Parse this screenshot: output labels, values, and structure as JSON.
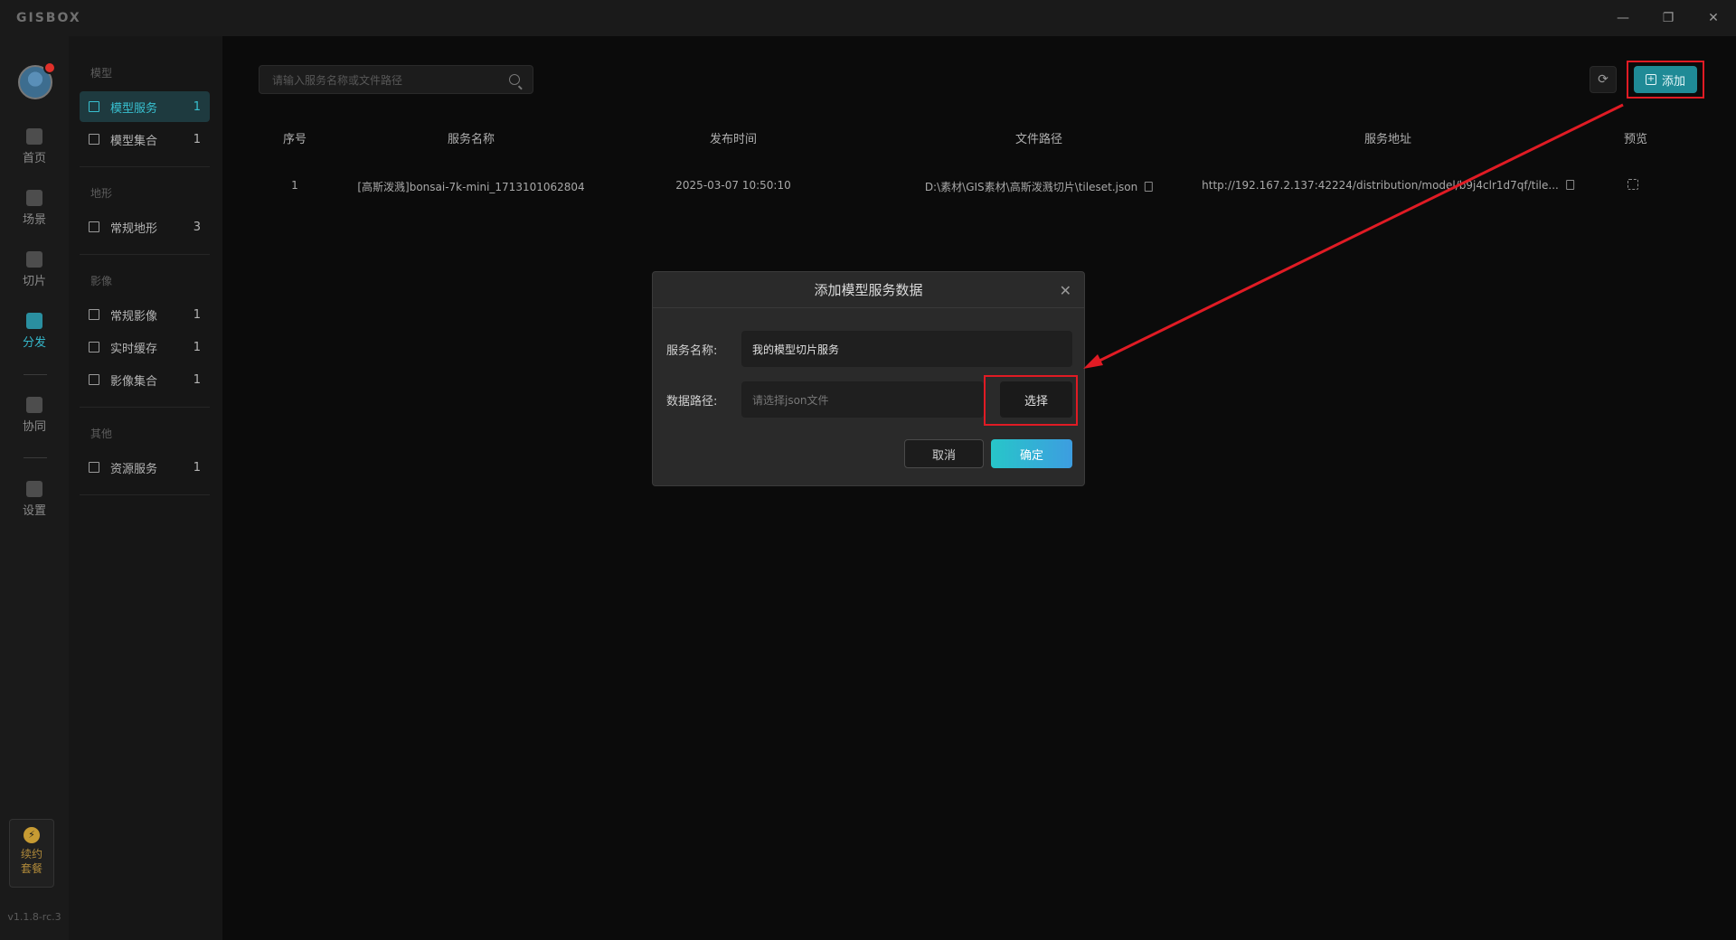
{
  "app": {
    "logo": "GISBOX"
  },
  "window": {
    "minimize": "—",
    "restore": "❐",
    "close": "✕"
  },
  "rail": {
    "items": [
      {
        "label": "首页",
        "icon": "home-icon"
      },
      {
        "label": "场景",
        "icon": "scene-icon"
      },
      {
        "label": "切片",
        "icon": "slice-icon"
      },
      {
        "label": "分发",
        "icon": "distribute-icon",
        "active": true
      },
      {
        "label": "协同",
        "icon": "collaborate-icon"
      },
      {
        "label": "设置",
        "icon": "settings-icon"
      }
    ],
    "renew": {
      "line1": "续约",
      "line2": "套餐"
    },
    "version": "v1.1.8-rc.3"
  },
  "sidebar": {
    "groups": [
      {
        "title": "模型",
        "items": [
          {
            "label": "模型服务",
            "count": "1",
            "active": true
          },
          {
            "label": "模型集合",
            "count": "1"
          }
        ]
      },
      {
        "title": "地形",
        "items": [
          {
            "label": "常规地形",
            "count": "3"
          }
        ]
      },
      {
        "title": "影像",
        "items": [
          {
            "label": "常规影像",
            "count": "1"
          },
          {
            "label": "实时缓存",
            "count": "1"
          },
          {
            "label": "影像集合",
            "count": "1"
          }
        ]
      },
      {
        "title": "其他",
        "items": [
          {
            "label": "资源服务",
            "count": "1"
          }
        ]
      }
    ]
  },
  "toolbar": {
    "search_placeholder": "请输入服务名称或文件路径",
    "add_label": "添加"
  },
  "table": {
    "headers": [
      "序号",
      "服务名称",
      "发布时间",
      "文件路径",
      "服务地址",
      "预览"
    ],
    "rows": [
      [
        "1",
        "[高斯泼溅]bonsai-7k-mini_1713101062804",
        "2025-03-07 10:50:10",
        "D:\\素材\\GIS素材\\高斯泼溅切片\\tileset.json",
        "http://192.167.2.137:42224/distribution/model/b9j4clr1d7qf/tile..."
      ]
    ]
  },
  "dialog": {
    "title": "添加模型服务数据",
    "name_label": "服务名称:",
    "name_value": "我的模型切片服务",
    "path_label": "数据路径:",
    "path_placeholder": "请选择json文件",
    "select_label": "选择",
    "cancel_label": "取消",
    "ok_label": "确定"
  },
  "colors": {
    "accent": "#1f8a96",
    "highlight": "#e01b24"
  }
}
